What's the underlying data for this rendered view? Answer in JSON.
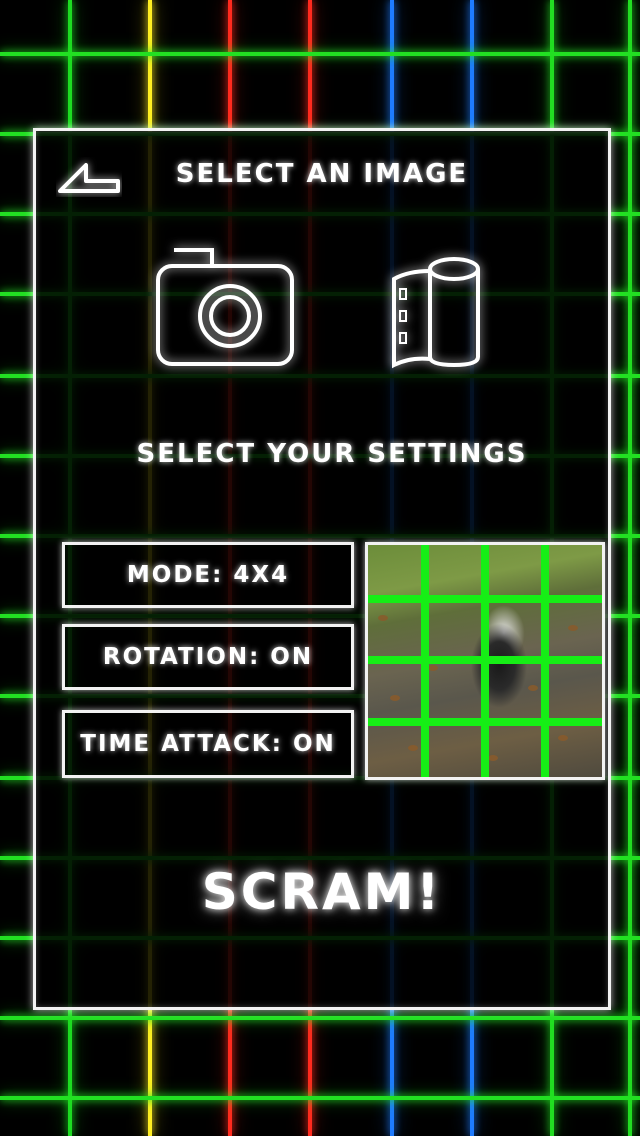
{
  "screen": {
    "title": "SELECT AN IMAGE",
    "settings_title": "SELECT YOUR SETTINGS"
  },
  "icons": {
    "back": "back-arrow-icon",
    "camera": "camera-icon",
    "gallery": "film-roll-icon"
  },
  "settings": {
    "mode": "MODE: 4X4",
    "rotation": "ROTATION: ON",
    "time_attack": "TIME ATTACK: ON"
  },
  "preview": {
    "grid_rows": 4,
    "grid_cols": 4,
    "grid_color": "#16ee16"
  },
  "start_button": "SCRAM!",
  "colors": {
    "grid_green": "#22dd22",
    "grid_yellow": "#ffee22",
    "grid_red": "#ff2a1e",
    "grid_blue": "#1e7bff",
    "panel_border": "#f2f2f2"
  }
}
